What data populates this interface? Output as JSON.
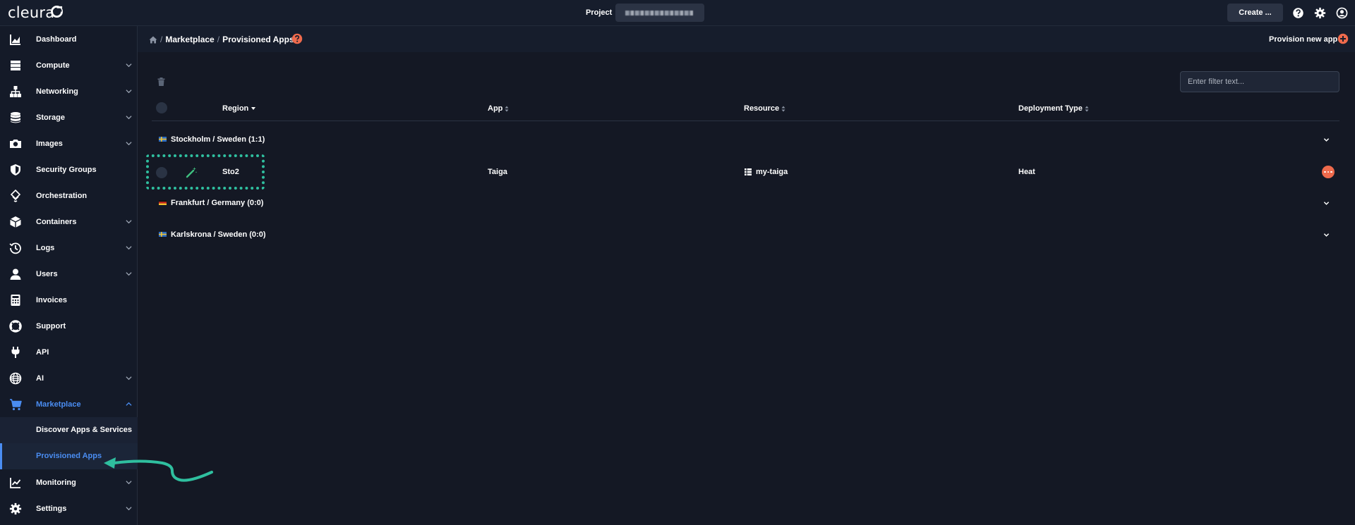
{
  "topbar": {
    "logo": "cleura",
    "project_label": "Project",
    "create_label": "Create ...",
    "icons": [
      "help-icon",
      "settings-gear-icon",
      "user-account-icon"
    ]
  },
  "sidebar": {
    "items": [
      {
        "label": "Dashboard",
        "icon": "dashboard-chart-icon"
      },
      {
        "label": "Compute",
        "icon": "compute-server-icon"
      },
      {
        "label": "Networking",
        "icon": "network-tree-icon"
      },
      {
        "label": "Storage",
        "icon": "storage-database-icon"
      },
      {
        "label": "Images",
        "icon": "camera-icon"
      },
      {
        "label": "Security Groups",
        "icon": "shield-icon"
      },
      {
        "label": "Orchestration",
        "icon": "orchestration-icon"
      },
      {
        "label": "Containers",
        "icon": "container-box-icon"
      },
      {
        "label": "Logs",
        "icon": "history-icon"
      },
      {
        "label": "Users",
        "icon": "user-icon"
      },
      {
        "label": "Invoices",
        "icon": "calculator-icon"
      },
      {
        "label": "Support",
        "icon": "lifebuoy-icon"
      },
      {
        "label": "API",
        "icon": "plug-icon"
      },
      {
        "label": "AI",
        "icon": "ai-icon"
      },
      {
        "label": "Marketplace",
        "icon": "cart-icon"
      },
      {
        "label": "Monitoring",
        "icon": "monitoring-chart-icon"
      },
      {
        "label": "Settings",
        "icon": "settings-gear-icon"
      }
    ],
    "marketplace_sub": {
      "discover": "Discover Apps & Services",
      "provisioned": "Provisioned Apps"
    }
  },
  "breadcrumb": {
    "parent": "Marketplace",
    "current": "Provisioned Apps",
    "separator": "/"
  },
  "provision": {
    "label": "Provision new app"
  },
  "filter": {
    "placeholder": "Enter filter text..."
  },
  "table": {
    "columns": {
      "region": "Region",
      "app": "App",
      "resource": "Resource",
      "deployment_type": "Deployment Type"
    },
    "groups": [
      {
        "name": "Stockholm / Sweden (1:1)",
        "flag": "sweden"
      },
      {
        "name": "Frankfurt / Germany (0:0)",
        "flag": "germany"
      },
      {
        "name": "Karlskrona / Sweden (0:0)",
        "flag": "sweden"
      }
    ],
    "row": {
      "region": "Sto2",
      "app": "Taiga",
      "resource": "my-taiga",
      "deployment_type": "Heat"
    }
  },
  "colors": {
    "accent": "#4a8df2",
    "danger": "#ee6a4c",
    "annotation": "#2fbf9f"
  }
}
